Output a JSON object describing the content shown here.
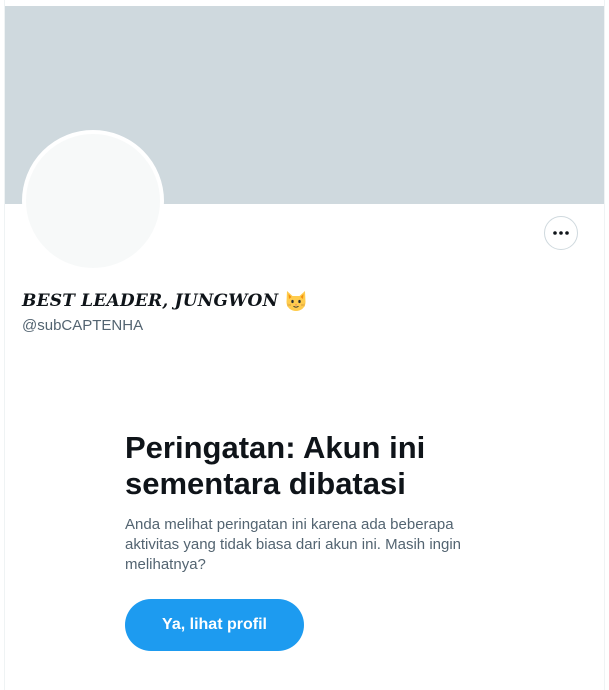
{
  "profile": {
    "display_name": "BEST LEADER, JUNGWON",
    "name_emoji": "cat-face-emoji",
    "handle": "@subCAPTENHA",
    "more_icon": "more-horizontal-icon"
  },
  "warning": {
    "title": "Peringatan: Akun ini sementara dibatasi",
    "description": "Anda melihat peringatan ini karena ada beberapa aktivitas yang tidak biasa dari akun ini. Masih ingin melihatnya?",
    "confirm_button": "Ya, lihat profil"
  },
  "colors": {
    "banner": "#cfd9de",
    "avatar": "#f7f9f9",
    "primary": "#1d9bf0",
    "text_primary": "#0f1419",
    "text_secondary": "#536471"
  }
}
